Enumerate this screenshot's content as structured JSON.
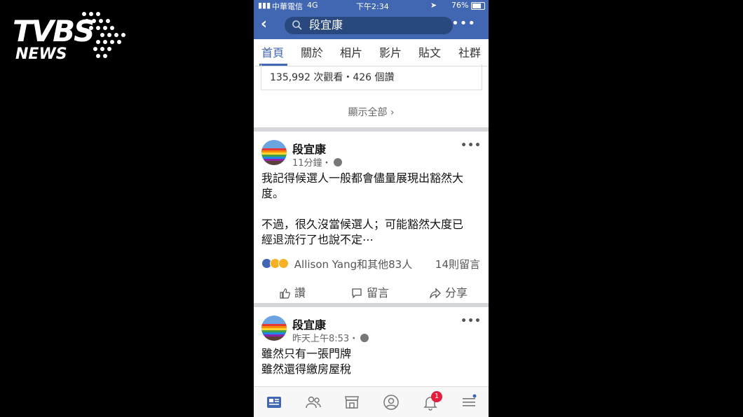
{
  "watermark": {
    "brand": "TVBS",
    "sub": "NEWS"
  },
  "status_bar": {
    "carrier": "中華電信",
    "network": "4G",
    "time": "下午2:34",
    "battery": "76%"
  },
  "nav": {
    "search_query": "段宜康"
  },
  "tabs": [
    {
      "label": "首頁",
      "active": true
    },
    {
      "label": "關於"
    },
    {
      "label": "相片"
    },
    {
      "label": "影片"
    },
    {
      "label": "貼文"
    },
    {
      "label": "社群"
    }
  ],
  "previous_card": {
    "stats": "135,992 次觀看・426 個讚"
  },
  "show_all": "顯示全部",
  "posts": [
    {
      "author": "段宜康",
      "time": "11分鐘・",
      "text_lines": [
        "我記得候選人一般都會儘量展現出豁然大",
        "度。",
        "",
        "不過，很久沒當候選人；可能豁然大度已",
        "經退流行了也說不定⋯"
      ],
      "reactions_text": "Allison Yang和其他83人",
      "comments_text": "14則留言"
    },
    {
      "author": "段宜康",
      "time": "昨天上午8:53・",
      "text_lines": [
        "雖然只有一張門牌",
        "雖然還得繳房屋稅"
      ]
    }
  ],
  "actions": {
    "like": "讚",
    "comment": "留言",
    "share": "分享"
  },
  "bottom_nav": {
    "icons": [
      "news-feed-icon",
      "friends-icon",
      "marketplace-icon",
      "profile-icon",
      "notifications-icon",
      "menu-icon"
    ],
    "notification_count": "1"
  },
  "colors": {
    "brand_blue": "#4267b2",
    "search_bg": "#29487d",
    "badge_red": "#e41e3f"
  }
}
